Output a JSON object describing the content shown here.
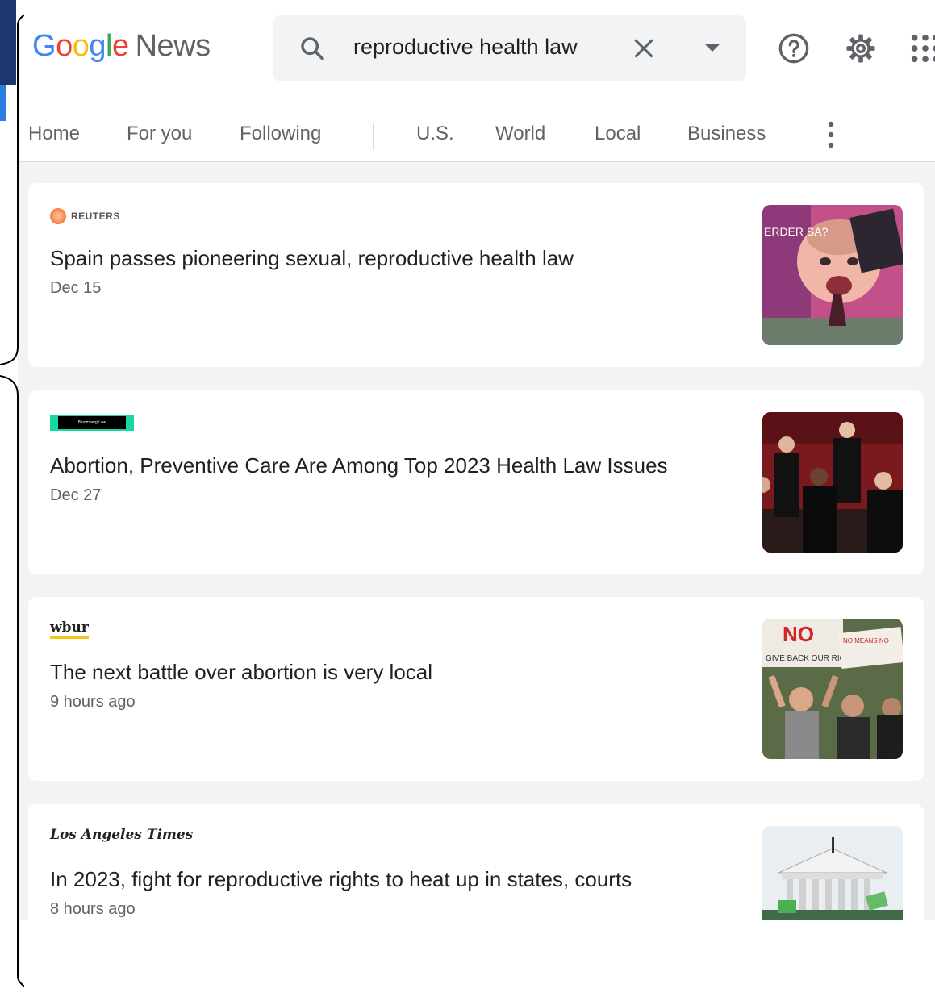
{
  "app": {
    "logo_brand": "Google",
    "logo_product": "News"
  },
  "search": {
    "query": "reproductive health law"
  },
  "header_icons": [
    "help-icon",
    "settings-gear-icon",
    "apps-grid-icon"
  ],
  "nav": {
    "tabs": [
      {
        "label": "Home"
      },
      {
        "label": "For you"
      },
      {
        "label": "Following"
      },
      {
        "label": "U.S."
      },
      {
        "label": "World"
      },
      {
        "label": "Local"
      },
      {
        "label": "Business"
      }
    ]
  },
  "articles": [
    {
      "source": "REUTERS",
      "headline": "Spain passes pioneering sexual, reproductive health law",
      "time": "Dec 15"
    },
    {
      "source": "Bloomberg Law",
      "headline": "Abortion, Preventive Care Are Among Top 2023 Health Law Issues",
      "time": "Dec 27"
    },
    {
      "source": "wbur",
      "headline": "The next battle over abortion is very local",
      "time": "9 hours ago"
    },
    {
      "source": "Los Angeles Times",
      "headline": "In 2023, fight for reproductive rights to heat up in states, courts",
      "time": "8 hours ago"
    }
  ],
  "thumb_texts": {
    "t1": "ERDER SA?",
    "t3a": "NO",
    "t3b": "GIVE BACK OUR RIGHTS",
    "t3c": "NO MEANS NO"
  },
  "colors": {
    "accent_blue": "#4285f4",
    "text_primary": "#202124",
    "text_secondary": "#5f6368",
    "feed_bg": "#f1f3f4"
  }
}
